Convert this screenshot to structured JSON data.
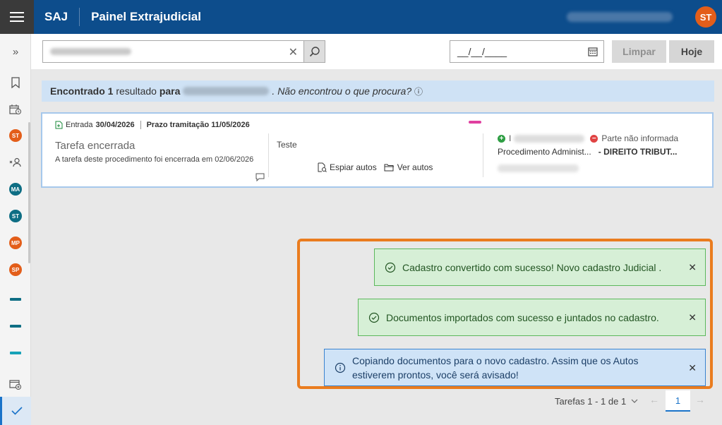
{
  "header": {
    "brand": "SAJ",
    "title": "Painel Extrajudicial",
    "user_initials": "ST"
  },
  "sidebar": {
    "expand_glyph": "»",
    "avatars": [
      {
        "initials": "ST",
        "color": "#e35e1a"
      },
      {
        "initials": "MA",
        "color": "#0e6e84"
      },
      {
        "initials": "ST",
        "color": "#0e6e84"
      },
      {
        "initials": "MP",
        "color": "#e35e1a"
      },
      {
        "initials": "SP",
        "color": "#e35e1a"
      }
    ],
    "bars": [
      "#0e6e84",
      "#0e6e84",
      "#17a2b8"
    ]
  },
  "search": {
    "value": "",
    "clear": "✕"
  },
  "date_filter": {
    "value": "__/__/____"
  },
  "buttons": {
    "clear": "Limpar",
    "today": "Hoje"
  },
  "result_banner": {
    "found_label": "Encontrado 1",
    "result_word": "resultado",
    "for_word": "para",
    "not_found_hint": ". Não encontrou o que procura?",
    "info": "ⓘ"
  },
  "card": {
    "entry_label": "Entrada",
    "entry_date": "30/04/2026",
    "deadline_label": "Prazo tramitação 11/05/2026",
    "status": "Tarefa encerrada",
    "description": "A tarefa deste procedimento foi encerrada em 02/06/2026",
    "note": "Teste",
    "peek_label": "Espiar autos",
    "view_label": "Ver autos",
    "party_prefix": "I",
    "party_missing": "Parte não informada",
    "procedure": "Procedimento Administ...",
    "subject": " - DIREITO TRIBUT..."
  },
  "toasts": [
    {
      "type": "success",
      "message": "Cadastro convertido com sucesso! Novo cadastro Judicial .",
      "close": "✕"
    },
    {
      "type": "success",
      "message": "Documentos importados com sucesso e juntados no cadastro.",
      "close": "✕"
    },
    {
      "type": "info",
      "line1": "Copiando documentos para o novo cadastro. Assim que os Autos",
      "line2": "estiverem prontos, você será avisado!",
      "close": "✕"
    }
  ],
  "pagination": {
    "label": "Tarefas 1 - 1 de 1",
    "current_page": "1",
    "prev": "←",
    "next": "→"
  },
  "colors": {
    "header_blue": "#0d4d8c",
    "accent_orange": "#ea7c1e",
    "success_green": "#5cb85c",
    "info_blue": "#3a83cf"
  }
}
